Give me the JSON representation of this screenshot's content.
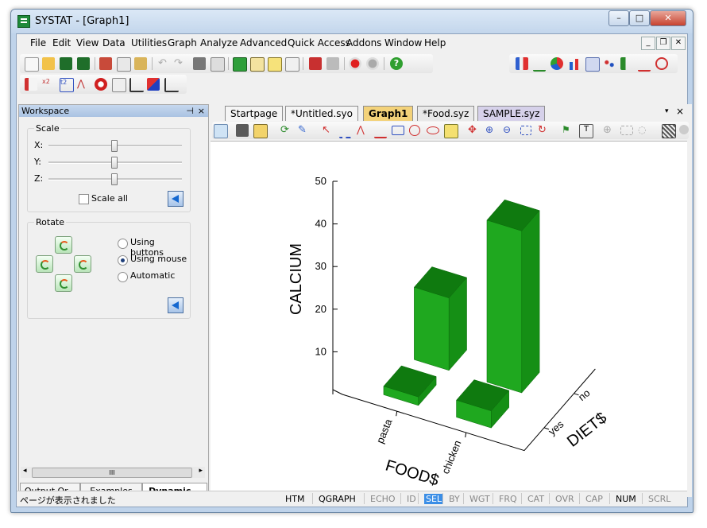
{
  "window": {
    "title": "SYSTAT - [Graph1]"
  },
  "menu": [
    "File",
    "Edit",
    "View",
    "Data",
    "Utilities",
    "Graph",
    "Analyze",
    "Advanced",
    "Quick Access",
    "Addons",
    "Window",
    "Help"
  ],
  "workspace": {
    "title": "Workspace",
    "scale": {
      "label": "Scale",
      "axes": [
        "X:",
        "Y:",
        "Z:"
      ],
      "scale_all_label": "Scale all",
      "scale_all_checked": false
    },
    "rotate": {
      "label": "Rotate",
      "options": [
        "Using buttons",
        "Using mouse",
        "Automatic"
      ],
      "selected": "Using mouse"
    },
    "bottom_tabs": [
      "Output Or...",
      "Examples",
      "Dynamic..."
    ],
    "active_bottom_tab": "Dynamic...",
    "scroll_grip": "III"
  },
  "doc_tabs": [
    "Startpage",
    "*Untitled.syo",
    "Graph1",
    "*Food.syz",
    "SAMPLE.syz"
  ],
  "active_doc_tab": "Graph1",
  "chart_data": {
    "type": "bar",
    "subtype": "3d-bar",
    "ylabel": "CALCIUM",
    "xlabel": "FOOD$",
    "zlabel": "DIET$",
    "x_categories": [
      "pasta",
      "chicken"
    ],
    "z_categories": [
      "yes",
      "no"
    ],
    "y_ticks": [
      10,
      20,
      30,
      40,
      50
    ],
    "ylim": [
      0,
      50
    ],
    "bars": [
      {
        "food": "pasta",
        "diet": "no",
        "value": 17
      },
      {
        "food": "chicken",
        "diet": "no",
        "value": 38
      },
      {
        "food": "pasta",
        "diet": "yes",
        "value": 2
      },
      {
        "food": "chicken",
        "diet": "yes",
        "value": 4
      }
    ],
    "bar_color": "#1fa81f"
  },
  "status": {
    "message": "ページが表示されました",
    "indicators": [
      {
        "label": "HTM",
        "on": true
      },
      {
        "label": "QGRAPH",
        "on": true
      },
      {
        "label": "ECHO",
        "on": false
      },
      {
        "label": "ID",
        "on": false
      },
      {
        "label": "SEL",
        "on": true,
        "selected": true
      },
      {
        "label": "BY",
        "on": false
      },
      {
        "label": "WGT",
        "on": false
      },
      {
        "label": "FRQ",
        "on": false
      },
      {
        "label": "CAT",
        "on": false
      },
      {
        "label": "OVR",
        "on": false
      },
      {
        "label": "CAP",
        "on": false
      },
      {
        "label": "NUM",
        "on": true
      },
      {
        "label": "SCRL",
        "on": false
      }
    ]
  },
  "colors": {
    "titlebar": "#c3d6ec",
    "accent": "#3b8ee6",
    "active_tab": "#f3d27a"
  }
}
